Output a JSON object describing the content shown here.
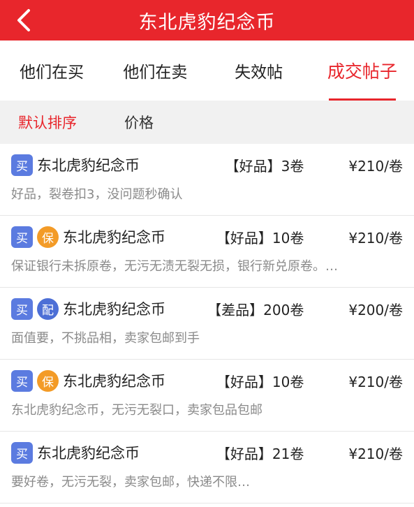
{
  "header": {
    "title": "东北虎豹纪念币"
  },
  "tabs": [
    {
      "label": "他们在买",
      "active": false
    },
    {
      "label": "他们在卖",
      "active": false
    },
    {
      "label": "失效帖",
      "active": false
    },
    {
      "label": "成交帖子",
      "active": true
    }
  ],
  "sort": {
    "default_label": "默认排序",
    "price_label": "价格"
  },
  "colors": {
    "accent": "#e8262c",
    "buy_badge": "#5b7be0",
    "guarantee_badge": "#f39b27",
    "delivery_badge": "#4d6fd6"
  },
  "items": [
    {
      "type_badge": "买",
      "extra_badge": "",
      "name": "东北虎豹纪念币",
      "grade": "【好品】3卷",
      "price": "¥210/卷",
      "desc": "好品，裂卷扣3，没问题秒确认"
    },
    {
      "type_badge": "买",
      "extra_badge": "保",
      "name": "东北虎豹纪念币",
      "grade": "【好品】10卷",
      "price": "¥210/卷",
      "desc": "保证银行未拆原卷，无污无渍无裂无损，银行新兑原卷。…"
    },
    {
      "type_badge": "买",
      "extra_badge": "配",
      "name": "东北虎豹纪念币",
      "grade": "【差品】200卷",
      "price": "¥200/卷",
      "desc": "面值要，不挑品相，卖家包邮到手"
    },
    {
      "type_badge": "买",
      "extra_badge": "保",
      "name": "东北虎豹纪念币",
      "grade": "【好品】10卷",
      "price": "¥210/卷",
      "desc": "东北虎豹纪念币，无污无裂口，卖家包品包邮"
    },
    {
      "type_badge": "买",
      "extra_badge": "",
      "name": "东北虎豹纪念币",
      "grade": "【好品】21卷",
      "price": "¥210/卷",
      "desc": "要好卷，无污无裂，卖家包邮，快递不限…"
    }
  ]
}
